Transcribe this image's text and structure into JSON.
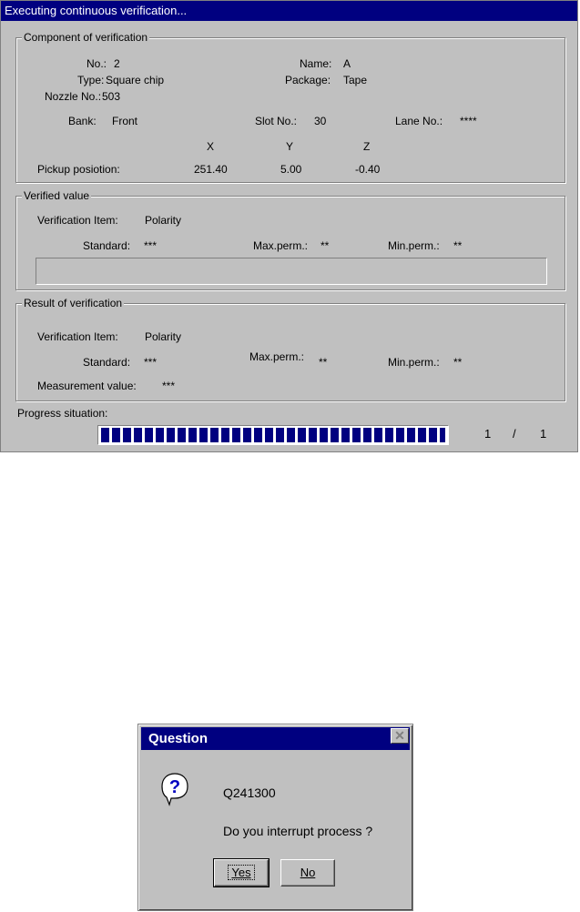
{
  "main": {
    "title": "Executing continuous verification...",
    "component": {
      "legend": "Component of verification",
      "no_label": "No.:",
      "no_value": "2",
      "name_label": "Name:",
      "name_value": "A",
      "type_label": "Type:",
      "type_value": "Square chip",
      "package_label": "Package:",
      "package_value": "Tape",
      "nozzle_label": "Nozzle No.:",
      "nozzle_value": "503",
      "bank_label": "Bank:",
      "bank_value": "Front",
      "slot_label": "Slot No.:",
      "slot_value": "30",
      "lane_label": "Lane No.:",
      "lane_value": "****",
      "col_x": "X",
      "col_y": "Y",
      "col_z": "Z",
      "pickup_label": "Pickup posiotion:",
      "pickup_x": "251.40",
      "pickup_y": "5.00",
      "pickup_z": "-0.40"
    },
    "verified": {
      "legend": "Verified value",
      "item_label": "Verification Item:",
      "item_value": "Polarity",
      "standard_label": "Standard:",
      "standard_value": "***",
      "maxperm_label": "Max.perm.:",
      "maxperm_value": "**",
      "minperm_label": "Min.perm.:",
      "minperm_value": "**"
    },
    "result": {
      "legend": "Result of verification",
      "item_label": "Verification Item:",
      "item_value": "Polarity",
      "standard_label": "Standard:",
      "standard_value": "***",
      "maxperm_label": "Max.perm.:",
      "maxperm_value": "**",
      "minperm_label": "Min.perm.:",
      "minperm_value": "**",
      "measurement_label": "Measurement value:",
      "measurement_value": "***"
    },
    "progress": {
      "label": "Progress situation:",
      "current": "1",
      "separator": "/",
      "total": "1",
      "fraction": 1.0
    }
  },
  "dialog": {
    "title": "Question",
    "icon": "question-icon",
    "code": "Q241300",
    "message": "Do you interrupt process ?",
    "yes_label": "Yes",
    "no_label": "No",
    "close_icon": "close-icon"
  },
  "colors": {
    "titlebar": "#000080",
    "window_bg": "#c0c0c0",
    "progress_fill": "#000080"
  }
}
